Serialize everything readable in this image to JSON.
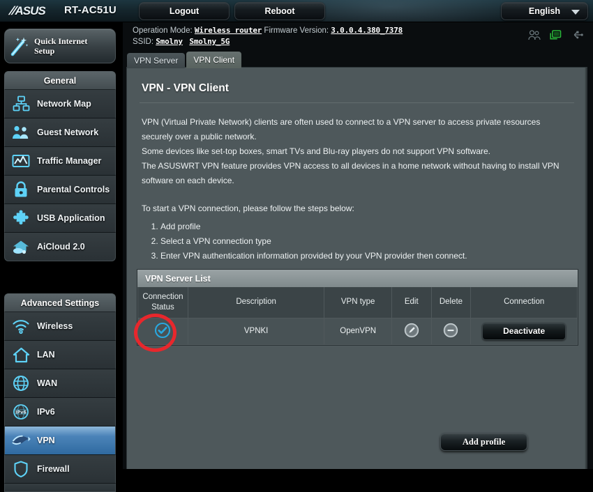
{
  "topbar": {
    "brand": "ASUS",
    "model": "RT-AC51U",
    "logout_label": "Logout",
    "reboot_label": "Reboot",
    "language": "English",
    "caret_icon": "chevron-down-icon"
  },
  "header": {
    "operation_mode_label": "Operation Mode:",
    "operation_mode_value": "Wireless router",
    "firmware_label": "Firmware Version:",
    "firmware_value": "3.0.0.4.380_7378",
    "ssid_label": "SSID:",
    "ssid_1": "Smolny",
    "ssid_2": "Smolny_5G",
    "status_icons": [
      "clients-icon",
      "network-monitor-icon",
      "usb-icon"
    ]
  },
  "tabs": [
    {
      "label": "VPN Server",
      "active": false
    },
    {
      "label": "VPN Client",
      "active": true
    }
  ],
  "sidebar": {
    "quick_setup": {
      "label_line1": "Quick Internet",
      "label_line2": "Setup",
      "icon": "magic-wand-icon"
    },
    "groups": [
      {
        "title": "General",
        "items": [
          {
            "label": "Network Map",
            "icon": "network-map-icon",
            "active": false
          },
          {
            "label": "Guest Network",
            "icon": "guest-network-icon",
            "active": false
          },
          {
            "label": "Traffic Manager",
            "icon": "traffic-manager-icon",
            "active": false
          },
          {
            "label": "Parental Controls",
            "icon": "lock-icon",
            "active": false
          },
          {
            "label": "USB Application",
            "icon": "puzzle-icon",
            "active": false
          },
          {
            "label": "AiCloud 2.0",
            "icon": "cloud-home-icon",
            "active": false
          }
        ]
      },
      {
        "title": "Advanced Settings",
        "items": [
          {
            "label": "Wireless",
            "icon": "wifi-icon",
            "active": false
          },
          {
            "label": "LAN",
            "icon": "home-icon",
            "active": false
          },
          {
            "label": "WAN",
            "icon": "globe-icon",
            "active": false
          },
          {
            "label": "IPv6",
            "icon": "ipv6-globe-icon",
            "active": false
          },
          {
            "label": "VPN",
            "icon": "vpn-icon",
            "active": true
          },
          {
            "label": "Firewall",
            "icon": "shield-icon",
            "active": false
          }
        ]
      }
    ]
  },
  "main": {
    "page_title": "VPN - VPN Client",
    "description": [
      "VPN (Virtual Private Network) clients are often used to connect to a VPN server to access private resources securely over a public network.",
      "Some devices like set-top boxes, smart TVs and Blu-ray players do not support VPN software.",
      "The ASUSWRT VPN feature provides VPN access to all devices in a home network without having to install VPN software on each device."
    ],
    "steps_intro": "To start a VPN connection, please follow the steps below:",
    "steps": [
      "Add profile",
      "Select a VPN connection type",
      "Enter VPN authentication information provided by your VPN provider then connect."
    ],
    "add_profile_label": "Add profile"
  },
  "table": {
    "title": "VPN Server List",
    "columns": [
      "Connection Status",
      "Description",
      "VPN type",
      "Edit",
      "Delete",
      "Connection"
    ],
    "column_status_line1": "Connection",
    "column_status_line2": "Status",
    "rows": [
      {
        "status": "connected",
        "status_icon": "check-circle-icon",
        "description": "VPNKI",
        "vpn_type": "OpenVPN",
        "edit_icon": "pencil-circle-icon",
        "delete_icon": "minus-circle-icon",
        "connection_label": "Deactivate"
      }
    ]
  },
  "annotation": {
    "shape": "red-ellipse-highlight",
    "target": "connection-status-cell",
    "color": "#e8272c"
  },
  "colors": {
    "accent_blue": "#29a8e0",
    "active_nav": "#2f6aa0",
    "content_bg": "#4e585b",
    "annotation_red": "#e8272c",
    "status_online_green": "#2fd441"
  }
}
